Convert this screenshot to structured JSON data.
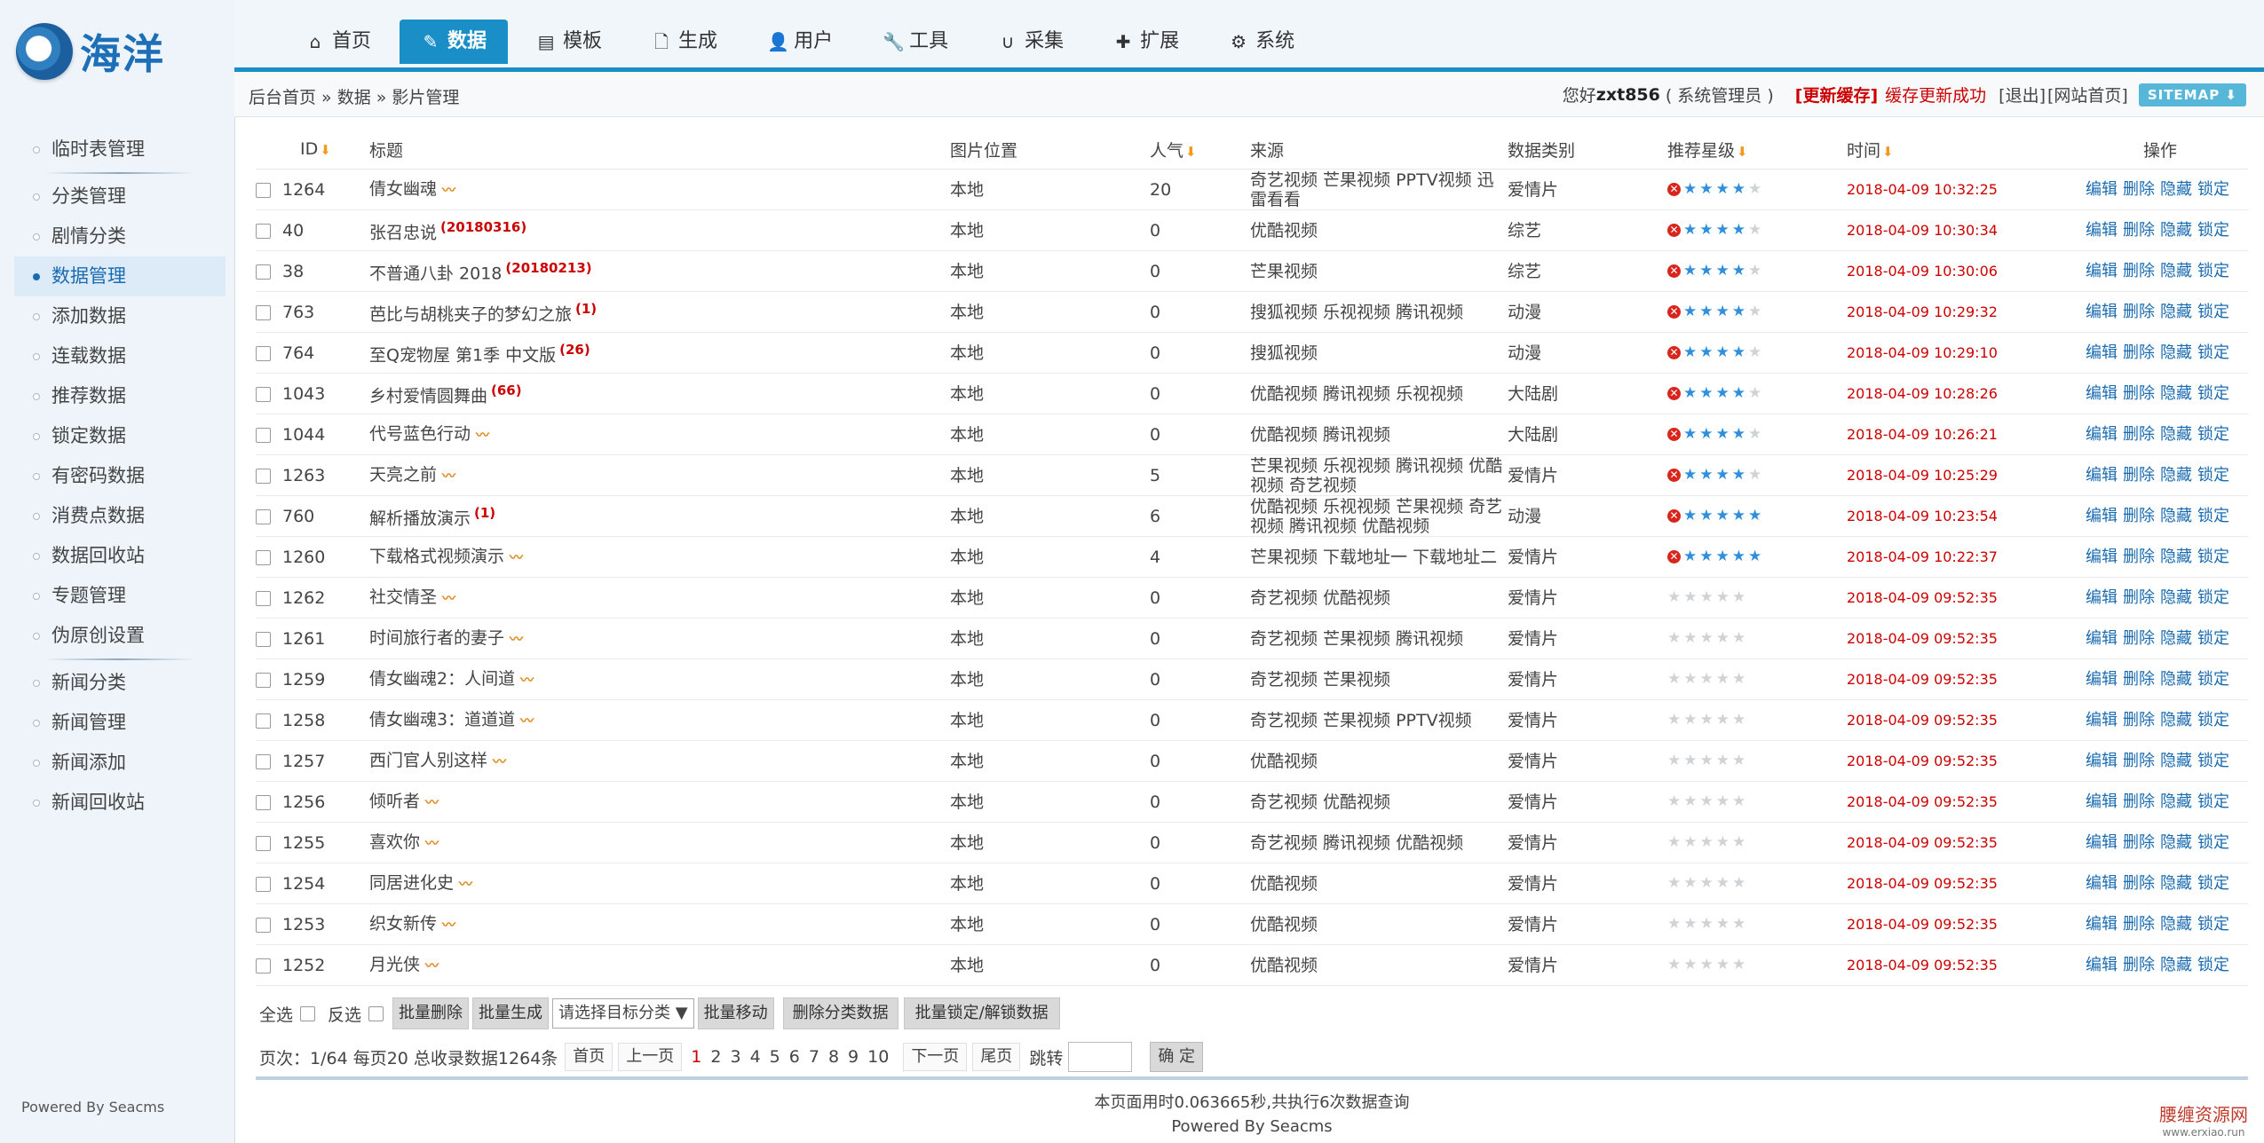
{
  "app": {
    "logo_text": "海洋"
  },
  "nav": {
    "tabs": [
      {
        "icon": "home-icon",
        "glyph": "⌂",
        "label": "首页"
      },
      {
        "icon": "edit-icon",
        "glyph": "✎",
        "label": "数据"
      },
      {
        "icon": "template-icon",
        "glyph": "▤",
        "label": "模板"
      },
      {
        "icon": "file-icon",
        "glyph": "🗋",
        "label": "生成"
      },
      {
        "icon": "user-icon",
        "glyph": "👤",
        "label": "用户"
      },
      {
        "icon": "wrench-icon",
        "glyph": "🔧",
        "label": "工具"
      },
      {
        "icon": "magnet-icon",
        "glyph": "∪",
        "label": "采集"
      },
      {
        "icon": "puzzle-icon",
        "glyph": "✚",
        "label": "扩展"
      },
      {
        "icon": "gear-icon",
        "glyph": "⚙",
        "label": "系统"
      }
    ],
    "active_index": 1
  },
  "breadcrumb": "后台首页 » 数据 » 影片管理",
  "userbar": {
    "greeting": "您好",
    "username": "zxt856",
    "role": "( 系统管理员 )",
    "update_cache": "[更新缓存]",
    "cache_msg": "缓存更新成功",
    "logout": "[退出]",
    "site_home": "[网站首页]",
    "sitemap": "SITEMAP ⬇"
  },
  "sidebar": {
    "groups": [
      [
        "临时表管理"
      ],
      [
        "分类管理",
        "剧情分类",
        "数据管理",
        "添加数据",
        "连载数据",
        "推荐数据",
        "锁定数据",
        "有密码数据",
        "消费点数据",
        "数据回收站",
        "专题管理",
        "伪原创设置"
      ],
      [
        "新闻分类",
        "新闻管理",
        "新闻添加",
        "新闻回收站"
      ]
    ],
    "active_label": "数据管理",
    "powered": "Powered By Seacms"
  },
  "table": {
    "headers": {
      "id": "ID",
      "title": "标题",
      "pic": "图片位置",
      "popularity": "人气",
      "source": "来源",
      "category": "数据类别",
      "stars": "推荐星级",
      "time": "时间",
      "ops": "操作"
    },
    "sort_glyph": "⬇",
    "op_labels": [
      "编辑",
      "删除",
      "隐藏",
      "锁定"
    ],
    "rows": [
      {
        "id": "1264",
        "title": "倩女幽魂",
        "tag": "",
        "hot": true,
        "pic": "本地",
        "pop": "20",
        "src": "奇艺视频 芒果视频 PPTV视频 迅雷看看",
        "cat": "爱情片",
        "stars": 4,
        "x": true,
        "time": "2018-04-09 10:32:25"
      },
      {
        "id": "40",
        "title": "张召忠说",
        "tag": "(20180316)",
        "hot": false,
        "pic": "本地",
        "pop": "0",
        "src": "优酷视频",
        "cat": "综艺",
        "stars": 4,
        "x": true,
        "time": "2018-04-09 10:30:34"
      },
      {
        "id": "38",
        "title": "不普通八卦 2018",
        "tag": "(20180213)",
        "hot": false,
        "pic": "本地",
        "pop": "0",
        "src": "芒果视频",
        "cat": "综艺",
        "stars": 4,
        "x": true,
        "time": "2018-04-09 10:30:06"
      },
      {
        "id": "763",
        "title": "芭比与胡桃夹子的梦幻之旅",
        "tag": "(1)",
        "hot": false,
        "pic": "本地",
        "pop": "0",
        "src": "搜狐视频 乐视视频 腾讯视频",
        "cat": "动漫",
        "stars": 4,
        "x": true,
        "time": "2018-04-09 10:29:32"
      },
      {
        "id": "764",
        "title": "至Q宠物屋 第1季 中文版",
        "tag": "(26)",
        "hot": false,
        "pic": "本地",
        "pop": "0",
        "src": "搜狐视频",
        "cat": "动漫",
        "stars": 4,
        "x": true,
        "time": "2018-04-09 10:29:10"
      },
      {
        "id": "1043",
        "title": "乡村爱情圆舞曲",
        "tag": "(66)",
        "hot": false,
        "pic": "本地",
        "pop": "0",
        "src": "优酷视频 腾讯视频 乐视视频",
        "cat": "大陆剧",
        "stars": 4,
        "x": true,
        "time": "2018-04-09 10:28:26"
      },
      {
        "id": "1044",
        "title": "代号蓝色行动",
        "tag": "",
        "hot": true,
        "pic": "本地",
        "pop": "0",
        "src": "优酷视频 腾讯视频",
        "cat": "大陆剧",
        "stars": 4,
        "x": true,
        "time": "2018-04-09 10:26:21"
      },
      {
        "id": "1263",
        "title": "天亮之前",
        "tag": "",
        "hot": true,
        "pic": "本地",
        "pop": "5",
        "src": "芒果视频 乐视视频 腾讯视频 优酷视频 奇艺视频",
        "cat": "爱情片",
        "stars": 4,
        "x": true,
        "time": "2018-04-09 10:25:29"
      },
      {
        "id": "760",
        "title": "解析播放演示",
        "tag": "(1)",
        "hot": false,
        "pic": "本地",
        "pop": "6",
        "src": "优酷视频 乐视视频 芒果视频 奇艺视频 腾讯视频 优酷视频",
        "cat": "动漫",
        "stars": 5,
        "x": true,
        "time": "2018-04-09 10:23:54"
      },
      {
        "id": "1260",
        "title": "下载格式视频演示",
        "tag": "",
        "hot": true,
        "pic": "本地",
        "pop": "4",
        "src": "芒果视频 下载地址一 下载地址二",
        "cat": "爱情片",
        "stars": 5,
        "x": true,
        "time": "2018-04-09 10:22:37"
      },
      {
        "id": "1262",
        "title": "社交情圣",
        "tag": "",
        "hot": true,
        "pic": "本地",
        "pop": "0",
        "src": "奇艺视频 优酷视频",
        "cat": "爱情片",
        "stars": 0,
        "x": false,
        "time": "2018-04-09 09:52:35"
      },
      {
        "id": "1261",
        "title": "时间旅行者的妻子",
        "tag": "",
        "hot": true,
        "pic": "本地",
        "pop": "0",
        "src": "奇艺视频 芒果视频 腾讯视频",
        "cat": "爱情片",
        "stars": 0,
        "x": false,
        "time": "2018-04-09 09:52:35"
      },
      {
        "id": "1259",
        "title": "倩女幽魂2：人间道",
        "tag": "",
        "hot": true,
        "pic": "本地",
        "pop": "0",
        "src": "奇艺视频 芒果视频",
        "cat": "爱情片",
        "stars": 0,
        "x": false,
        "time": "2018-04-09 09:52:35"
      },
      {
        "id": "1258",
        "title": "倩女幽魂3：道道道",
        "tag": "",
        "hot": true,
        "pic": "本地",
        "pop": "0",
        "src": "奇艺视频 芒果视频 PPTV视频",
        "cat": "爱情片",
        "stars": 0,
        "x": false,
        "time": "2018-04-09 09:52:35"
      },
      {
        "id": "1257",
        "title": "西门官人别这样",
        "tag": "",
        "hot": true,
        "pic": "本地",
        "pop": "0",
        "src": "优酷视频",
        "cat": "爱情片",
        "stars": 0,
        "x": false,
        "time": "2018-04-09 09:52:35"
      },
      {
        "id": "1256",
        "title": "倾听者",
        "tag": "",
        "hot": true,
        "pic": "本地",
        "pop": "0",
        "src": "奇艺视频 优酷视频",
        "cat": "爱情片",
        "stars": 0,
        "x": false,
        "time": "2018-04-09 09:52:35"
      },
      {
        "id": "1255",
        "title": "喜欢你",
        "tag": "",
        "hot": true,
        "pic": "本地",
        "pop": "0",
        "src": "奇艺视频 腾讯视频 优酷视频",
        "cat": "爱情片",
        "stars": 0,
        "x": false,
        "time": "2018-04-09 09:52:35"
      },
      {
        "id": "1254",
        "title": "同居进化史",
        "tag": "",
        "hot": true,
        "pic": "本地",
        "pop": "0",
        "src": "优酷视频",
        "cat": "爱情片",
        "stars": 0,
        "x": false,
        "time": "2018-04-09 09:52:35"
      },
      {
        "id": "1253",
        "title": "织女新传",
        "tag": "",
        "hot": true,
        "pic": "本地",
        "pop": "0",
        "src": "优酷视频",
        "cat": "爱情片",
        "stars": 0,
        "x": false,
        "time": "2018-04-09 09:52:35"
      },
      {
        "id": "1252",
        "title": "月光侠",
        "tag": "",
        "hot": true,
        "pic": "本地",
        "pop": "0",
        "src": "优酷视频",
        "cat": "爱情片",
        "stars": 0,
        "x": false,
        "time": "2018-04-09 09:52:35"
      }
    ]
  },
  "batch": {
    "select_all": "全选",
    "invert": "反选",
    "batch_delete": "批量删除",
    "batch_generate": "批量生成",
    "target_select": "请选择目标分类 ▼",
    "batch_move": "批量移动",
    "delete_category": "删除分类数据",
    "batch_lock": "批量锁定/解锁数据"
  },
  "pagination": {
    "info": "页次：1/64 每页20 总收录数据1264条",
    "first": "首页",
    "prev": "上一页",
    "pages": [
      "1",
      "2",
      "3",
      "4",
      "5",
      "6",
      "7",
      "8",
      "9",
      "10"
    ],
    "current": "1",
    "next": "下一页",
    "last": "尾页",
    "jump": "跳转",
    "ok": "确 定"
  },
  "footer": {
    "timing": "本页面用时0.063665秒,共执行6次数据查询",
    "powered": "Powered By Seacms"
  },
  "watermark": {
    "text": "腰缠资源网",
    "url": "www.erxiao.run"
  },
  "colors": {
    "accent": "#1a8fc7",
    "danger": "#cc0000",
    "star_on": "#2f8fdc",
    "sidebar_bg": "#eef4fa"
  }
}
